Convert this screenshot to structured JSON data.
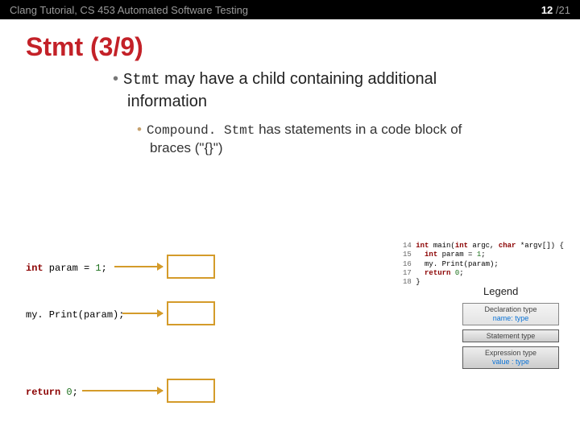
{
  "header": {
    "left": "Clang Tutorial, CS 453 Automated Software Testing",
    "page_current": "12",
    "page_sep": " /",
    "page_total": "21"
  },
  "title": "Stmt (3/9)",
  "bullet1": {
    "pre": "Stmt",
    "rest": " may have a child containing additional",
    "cont": "information"
  },
  "bullet2": {
    "pre": "Compound. Stmt",
    "rest": " has statements in a code block of",
    "cont": "braces (\"{}\")"
  },
  "snippets": {
    "s1_kw": "int",
    "s1_rest": " param = ",
    "s1_num": "1",
    "s1_end": ";",
    "s2": "my. Print(param);",
    "s3_kw": "return",
    "s3_sp": " ",
    "s3_num": "0",
    "s3_end": ";"
  },
  "code": {
    "l14_ln": "14",
    "l14_a": " int",
    "l14_b": " main(",
    "l14_c": "int",
    "l14_d": " argc, ",
    "l14_e": "char",
    "l14_f": " *argv[]) {",
    "l15_ln": "15",
    "l15_a": "   int",
    "l15_b": " param = ",
    "l15_num": "1",
    "l15_c": ";",
    "l16_ln": "16",
    "l16_a": "   my. Print(param);",
    "l17_ln": "17",
    "l17_a": "   return",
    "l17_sp": " ",
    "l17_num": "0",
    "l17_b": ";",
    "l18_ln": "18",
    "l18_a": " }"
  },
  "legend": {
    "title": "Legend",
    "box1_l1": "Declaration type",
    "box1_l2": "name: type",
    "box2_l1": "Statement type",
    "box3_l1": "Expression type",
    "box3_l2": "value : type"
  }
}
